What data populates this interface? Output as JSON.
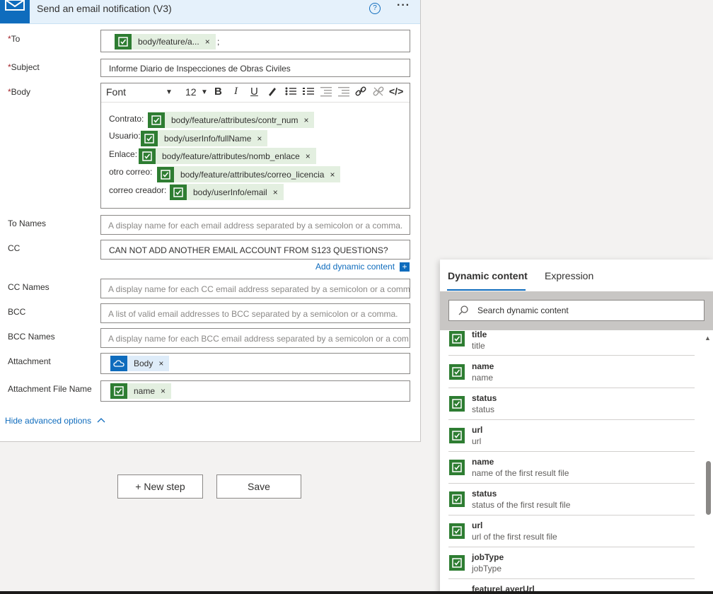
{
  "card": {
    "title": "Send an email notification (V3)",
    "help_glyph": "?",
    "more_glyph": "···"
  },
  "fields": {
    "to": {
      "label": "To",
      "required": "*",
      "token": "body/feature/a...",
      "token_close": "×",
      "trailing": ";"
    },
    "subject": {
      "label": "Subject",
      "required": "*",
      "value": "Informe Diario de Inspecciones de Obras Civiles"
    },
    "body": {
      "label": "Body",
      "required": "*"
    },
    "to_names": {
      "label": "To Names",
      "placeholder": "A display name for each email address separated by a semicolon or a comma."
    },
    "cc": {
      "label": "CC",
      "value": "CAN NOT ADD ANOTHER EMAIL ACCOUNT FROM S123 QUESTIONS?"
    },
    "cc_names": {
      "label": "CC Names",
      "placeholder": "A display name for each CC email address separated by a semicolon or a comm"
    },
    "bcc": {
      "label": "BCC",
      "placeholder": "A list of valid email addresses to BCC separated by a semicolon or a comma."
    },
    "bcc_names": {
      "label": "BCC Names",
      "placeholder": "A display name for each BCC email address separated by a semicolon or a com"
    },
    "attachment": {
      "label": "Attachment",
      "token": "Body",
      "token_close": "×"
    },
    "attachment_name": {
      "label": "Attachment File Name",
      "token": "name",
      "token_close": "×"
    }
  },
  "editor": {
    "font": "Font",
    "size": "12",
    "bold": "B",
    "italic": "I",
    "underline": "U",
    "code": "</>",
    "lines": [
      {
        "label": "Contrato:",
        "token": "body/feature/attributes/contr_num",
        "close": "×"
      },
      {
        "label": "Usuario:",
        "token": "body/userInfo/fullName",
        "close": "×"
      },
      {
        "label": "Enlace:",
        "token": "body/feature/attributes/nomb_enlace",
        "close": "×"
      },
      {
        "label": "otro correo:",
        "token": "body/feature/attributes/correo_licencia",
        "close": "×"
      },
      {
        "label": "correo creador:",
        "token": "body/userInfo/email",
        "close": "×"
      }
    ]
  },
  "add_dynamic": {
    "label": "Add dynamic content",
    "plus": "+"
  },
  "hide_advanced": "Hide advanced options",
  "buttons": {
    "new_step": "+ New step",
    "save": "Save"
  },
  "panel": {
    "tab_dynamic": "Dynamic content",
    "tab_expression": "Expression",
    "search_placeholder": "Search dynamic content",
    "items": [
      {
        "title": "title",
        "desc": "title"
      },
      {
        "title": "name",
        "desc": "name"
      },
      {
        "title": "status",
        "desc": "status"
      },
      {
        "title": "url",
        "desc": "url"
      },
      {
        "title": "name",
        "desc": "name of the first result file"
      },
      {
        "title": "status",
        "desc": "status of the first result file"
      },
      {
        "title": "url",
        "desc": "url of the first result file"
      },
      {
        "title": "jobType",
        "desc": "jobType"
      },
      {
        "title": "featureLayerUrl",
        "desc": ""
      }
    ]
  },
  "colors": {
    "accent": "#0f6cbd",
    "token_green": "#2e7d32",
    "token_bg": "#e3efe0",
    "required": "#a4262c"
  }
}
